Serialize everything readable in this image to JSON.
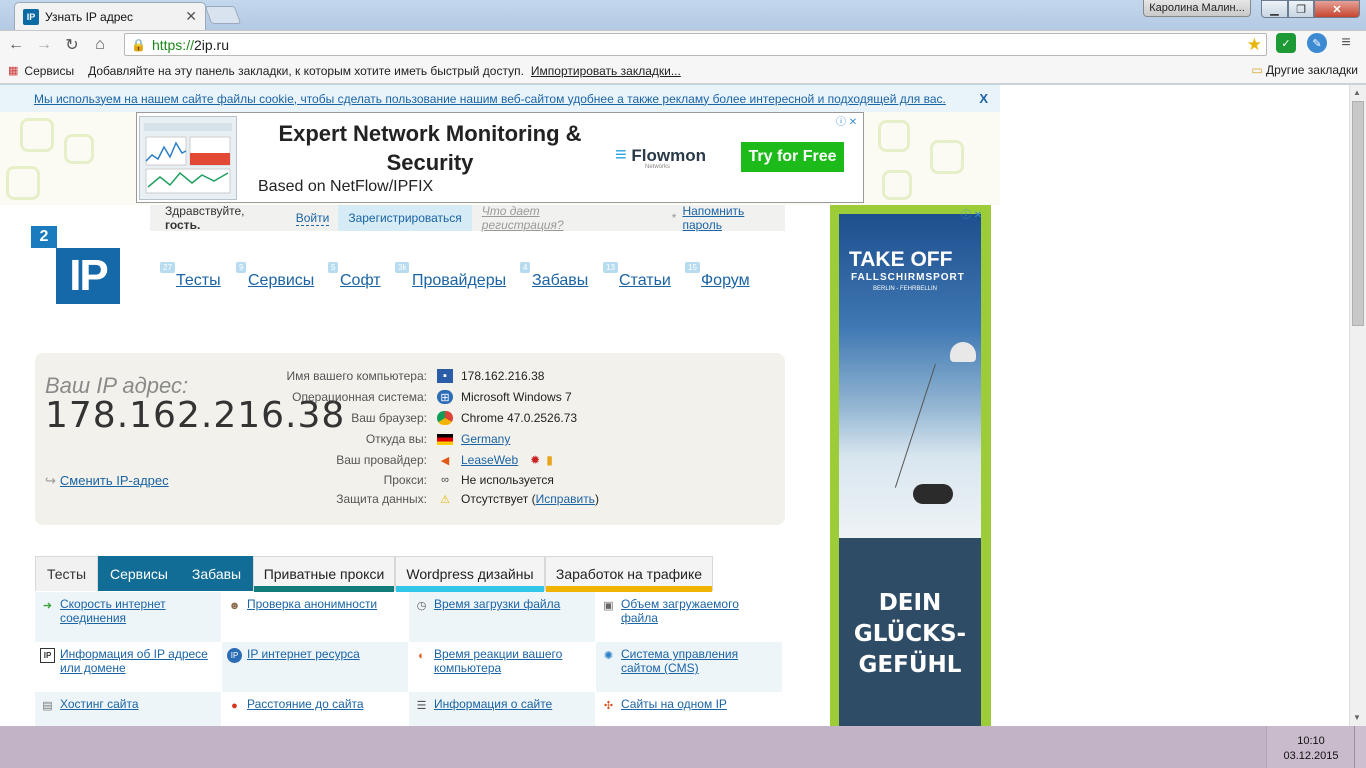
{
  "browser": {
    "tab_title": "Узнать IP адрес",
    "tab_favicon": "IP",
    "tab_close": "✕",
    "user_name": "Каролина Малин...",
    "url_scheme": "https://",
    "url_host": "2ip.ru",
    "bookmarks": {
      "apps": "Сервисы",
      "hint": "Добавляйте на эту панель закладки, к которым хотите иметь быстрый доступ.",
      "import": "Импортировать закладки...",
      "other": "Другие закладки"
    }
  },
  "cookie": {
    "text": "Мы используем на нашем сайте файлы cookie, чтобы сделать пользование нашим веб-сайтом удобнее а также рекламу более интересной и подходящей для вас.",
    "close": "X"
  },
  "ad_top": {
    "headline": "Expert Network Monitoring & Security",
    "subline": "Based on NetFlow/IPFIX",
    "brand": "Flowmon",
    "brand_sub": "Networks",
    "cta": "Try for Free"
  },
  "greet": {
    "hello": "Здравствуйте,",
    "guest": "гость.",
    "login": "Войти",
    "register": "Зарегистрироваться",
    "why": "Что дает регистрация?",
    "star": "*",
    "remind": "Напомнить пароль"
  },
  "logo": {
    "small": "2",
    "big": "IP"
  },
  "menu": [
    {
      "label": "Тесты",
      "count": "27"
    },
    {
      "label": "Сервисы",
      "count": "9"
    },
    {
      "label": "Софт",
      "count": "5"
    },
    {
      "label": "Провайдеры",
      "count": "3k"
    },
    {
      "label": "Забавы",
      "count": "4"
    },
    {
      "label": "Статьи",
      "count": "13"
    },
    {
      "label": "Форум",
      "count": "15"
    }
  ],
  "ipinfo": {
    "label": "Ваш IP адрес:",
    "ip": "178.162.216.38",
    "change": "Сменить IP-адрес",
    "rows": [
      {
        "key": "Имя вашего компьютера:",
        "value": "178.162.216.38",
        "icon": "computer-icon"
      },
      {
        "key": "Операционная система:",
        "value": "Microsoft Windows 7",
        "icon": "windows-icon"
      },
      {
        "key": "Ваш браузер:",
        "value": "Chrome 47.0.2526.73",
        "icon": "chrome-icon"
      },
      {
        "key": "Откуда вы:",
        "value": "Germany",
        "icon": "flag-germany-icon"
      },
      {
        "key": "Ваш провайдер:",
        "value": "LeaseWeb",
        "icon": "provider-icon"
      },
      {
        "key": "Прокси:",
        "value": "Не используется",
        "icon": "glasses-icon"
      },
      {
        "key": "Защита данных:",
        "value": "Отсутствует (",
        "link": "Исправить",
        "suffix": ")",
        "icon": "warning-icon"
      }
    ]
  },
  "tabs": [
    {
      "label": "Тесты",
      "color": "#f1f1f1",
      "text": "#333",
      "bar": "#f1f1f1"
    },
    {
      "label": "Сервисы",
      "color": "#126d96",
      "text": "#ffffff",
      "bar": "#126d96"
    },
    {
      "label": "Забавы",
      "color": "#126d96",
      "text": "#ffffff",
      "bar": "#126d96"
    },
    {
      "label": "Приватные прокси",
      "color": "#f4f4f4",
      "text": "#222",
      "bar": "#117c7a"
    },
    {
      "label": "Wordpress дизайны",
      "color": "#f4f4f4",
      "text": "#222",
      "bar": "#33c6e8"
    },
    {
      "label": "Заработок на трафике",
      "color": "#f4f4f4",
      "text": "#222",
      "bar": "#f0b400"
    }
  ],
  "services": [
    {
      "label": "Скорость интернет соединения",
      "icon": "speed-icon"
    },
    {
      "label": "Проверка анонимности",
      "icon": "anonymity-icon"
    },
    {
      "label": "Время загрузки файла",
      "icon": "clock-icon"
    },
    {
      "label": "Объем загружаемого файла",
      "icon": "file-size-icon"
    },
    {
      "label": "Информация об IP адресе или домене",
      "icon": "ip-info-icon"
    },
    {
      "label": "IP интернет ресурса",
      "icon": "ip-resource-icon"
    },
    {
      "label": "Время реакции вашего компьютера",
      "icon": "reaction-icon"
    },
    {
      "label": "Система управления сайтом (CMS)",
      "icon": "cms-icon"
    },
    {
      "label": "Хостинг сайта",
      "icon": "hosting-icon"
    },
    {
      "label": "Расстояние до сайта",
      "icon": "map-pin-icon"
    },
    {
      "label": "Информация о сайте",
      "icon": "site-info-icon"
    },
    {
      "label": "Сайты на одном IP",
      "icon": "sites-on-ip-icon"
    }
  ],
  "ad_side": {
    "title": "TAKE OFF",
    "subtitle": "FALLSCHIRMSPORT",
    "place": "BERLIN - FEHRBELLIN",
    "slogan1": "DEIN",
    "slogan2": "GLÜCKS-",
    "slogan3": "GEFÜHL"
  },
  "taskbar": {
    "time": "10:10",
    "date": "03.12.2015"
  }
}
